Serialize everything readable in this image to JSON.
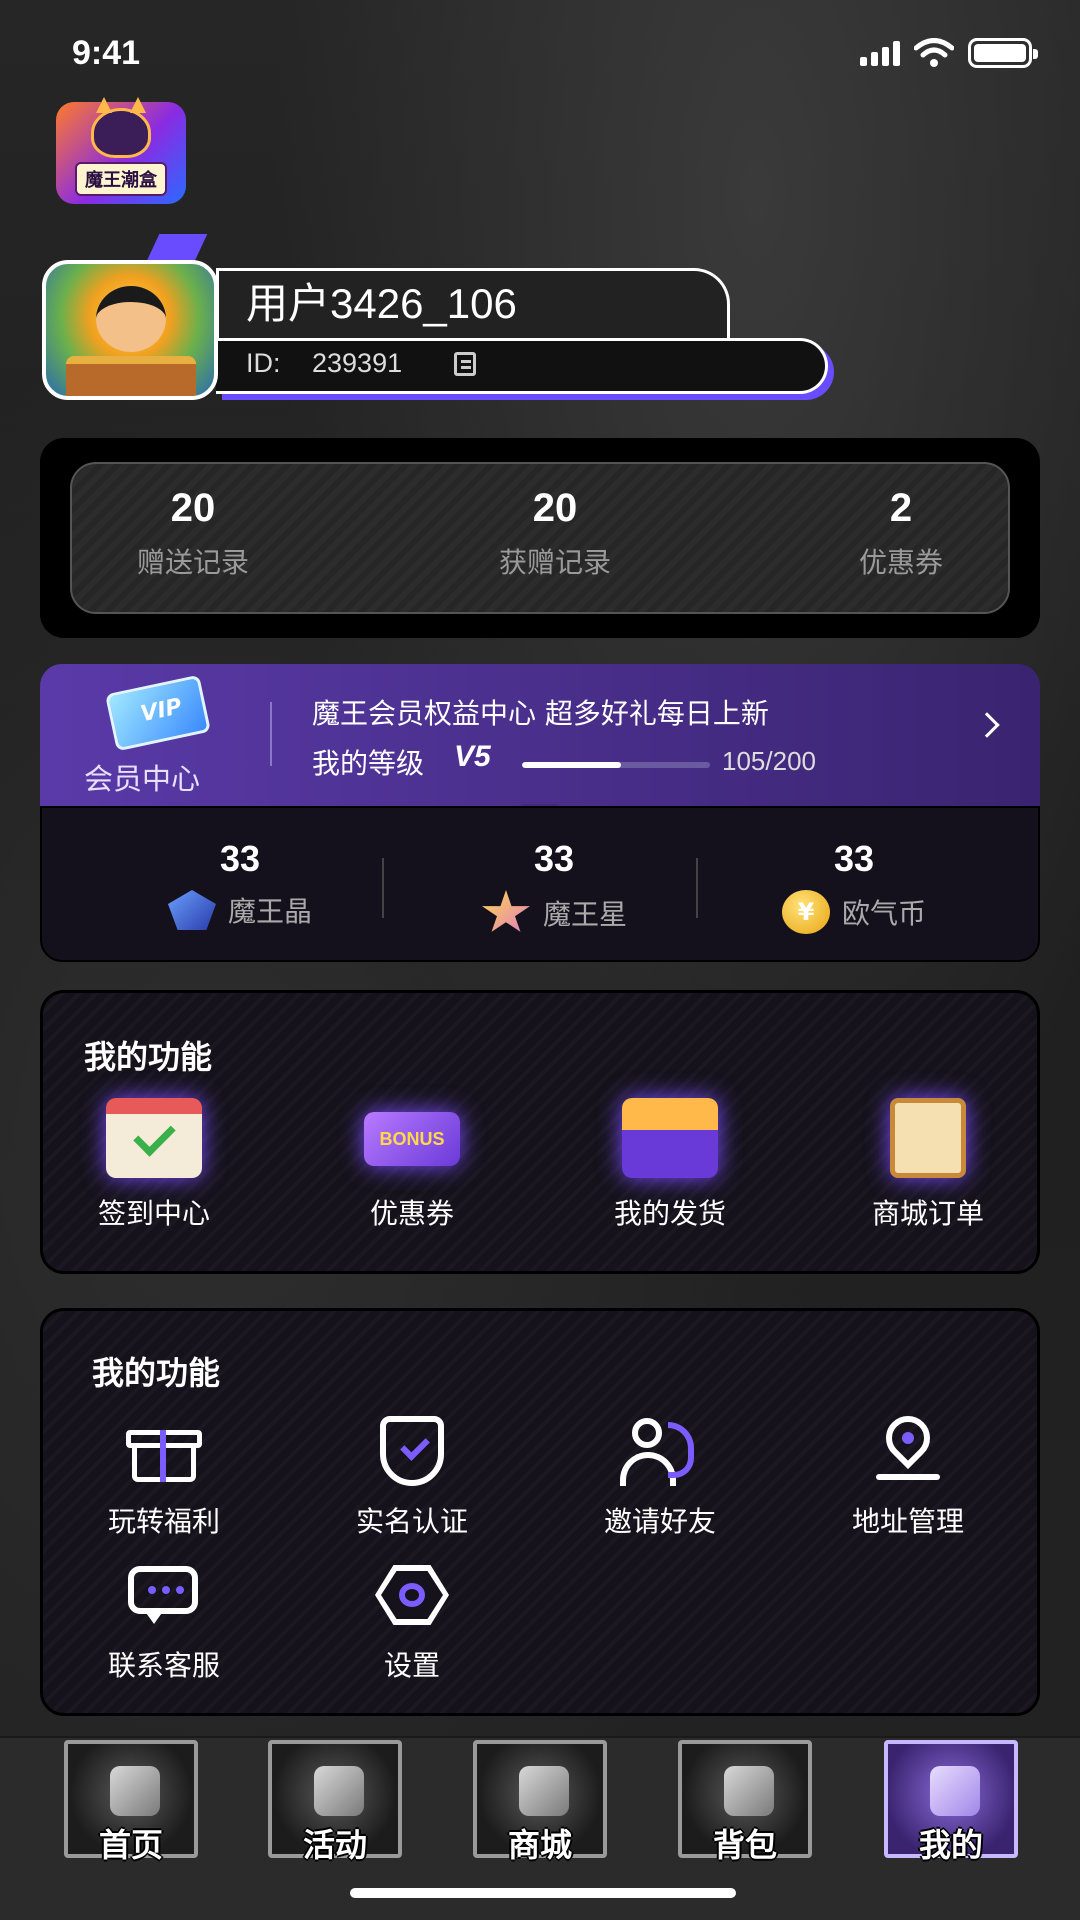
{
  "status_bar": {
    "time": "9:41"
  },
  "app": {
    "logo_text": "魔王潮盒"
  },
  "profile": {
    "username": "用户3426_106",
    "id_label": "ID:",
    "id_value": "239391"
  },
  "stats": [
    {
      "value": "20",
      "label": "赠送记录"
    },
    {
      "value": "20",
      "label": "获赠记录"
    },
    {
      "value": "2",
      "label": "优惠券"
    }
  ],
  "vip": {
    "center_label": "会员中心",
    "card_text": "VIP",
    "title": "魔王会员权益中心  超多好礼每日上新",
    "level_label": "我的等级",
    "level": "V5",
    "progress_text": "105/200",
    "progress_fraction": 0.525
  },
  "currencies": [
    {
      "value": "33",
      "label": "魔王晶",
      "icon": "crystal-icon"
    },
    {
      "value": "33",
      "label": "魔王星",
      "icon": "star-icon"
    },
    {
      "value": "33",
      "label": "欧气币",
      "icon": "coin-icon",
      "symbol": "¥"
    }
  ],
  "features_1": {
    "title": "我的功能",
    "items": [
      {
        "label": "签到中心",
        "icon": "calendar-icon"
      },
      {
        "label": "优惠券",
        "icon": "voucher-icon",
        "badge_text": "BONUS"
      },
      {
        "label": "我的发货",
        "icon": "box-icon"
      },
      {
        "label": "商城订单",
        "icon": "clipboard-icon"
      }
    ]
  },
  "features_2": {
    "title": "我的功能",
    "items": [
      {
        "label": "玩转福利",
        "icon": "gift-icon"
      },
      {
        "label": "实名认证",
        "icon": "shield-icon"
      },
      {
        "label": "邀请好友",
        "icon": "friends-icon"
      },
      {
        "label": "地址管理",
        "icon": "location-icon"
      },
      {
        "label": "联系客服",
        "icon": "chat-icon"
      },
      {
        "label": "设置",
        "icon": "settings-icon"
      }
    ]
  },
  "tab_bar": {
    "active": "我的",
    "tabs": [
      {
        "label": "首页",
        "icon": "helmet-icon"
      },
      {
        "label": "活动",
        "icon": "shield-eye-icon"
      },
      {
        "label": "商城",
        "icon": "shop-icon"
      },
      {
        "label": "背包",
        "icon": "backpack-icon"
      },
      {
        "label": "我的",
        "icon": "castle-icon"
      }
    ]
  },
  "colors": {
    "accent": "#7a5cff",
    "vip_gradient_start": "#5a3aa8",
    "card_bg": "#15121b"
  }
}
